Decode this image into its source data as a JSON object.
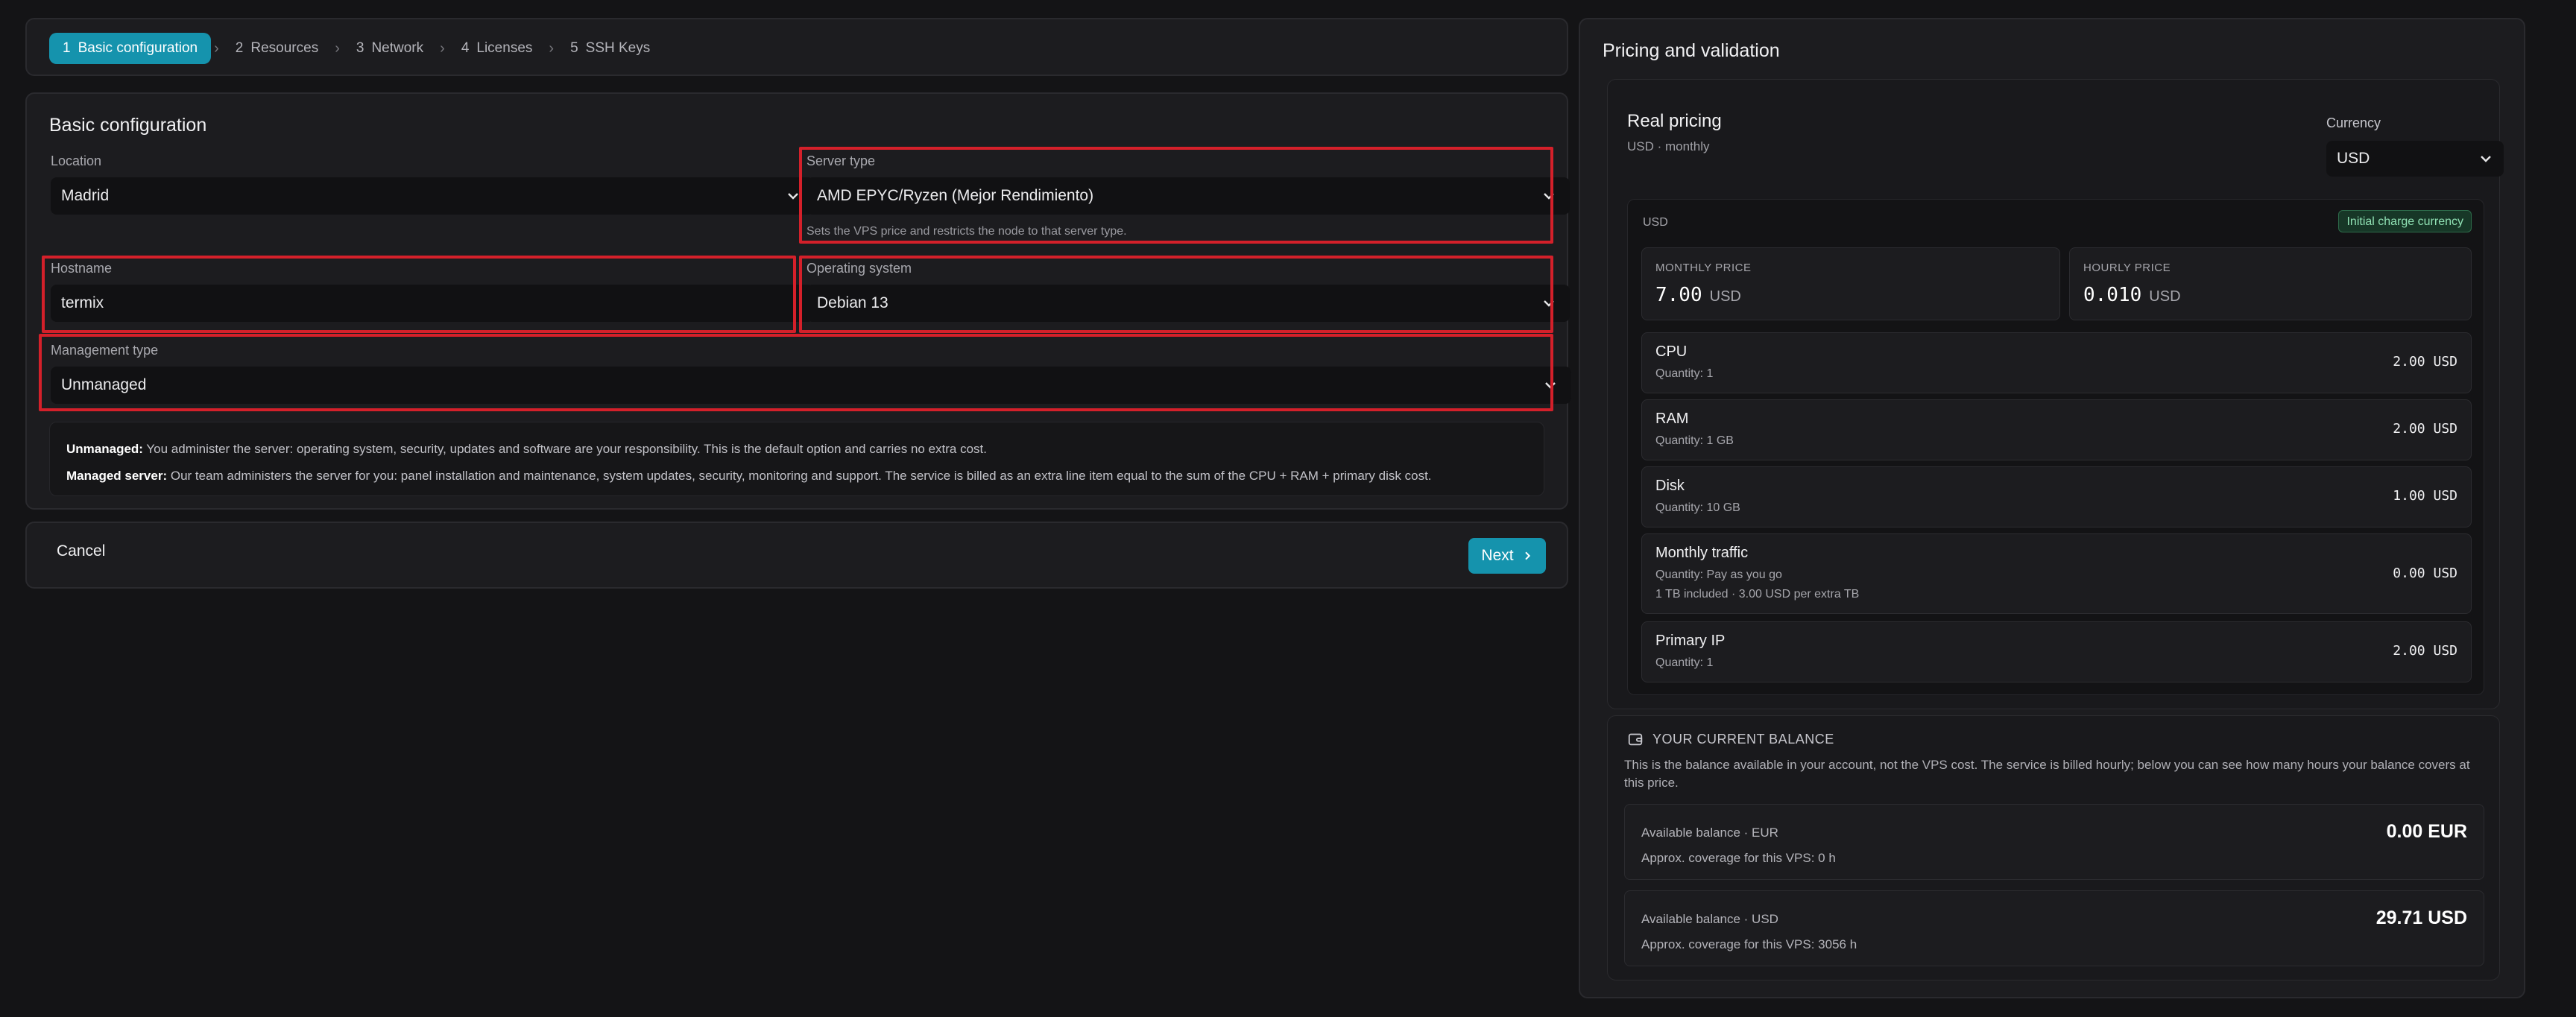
{
  "stepper": {
    "steps": [
      {
        "num": "1",
        "label": "Basic configuration"
      },
      {
        "num": "2",
        "label": "Resources"
      },
      {
        "num": "3",
        "label": "Network"
      },
      {
        "num": "4",
        "label": "Licenses"
      },
      {
        "num": "5",
        "label": "SSH Keys"
      }
    ],
    "active_index": 0
  },
  "config": {
    "title": "Basic configuration",
    "location": {
      "label": "Location",
      "value": "Madrid"
    },
    "server_type": {
      "label": "Server type",
      "value": "AMD EPYC/Ryzen (Mejor Rendimiento)",
      "hint": "Sets the VPS price and restricts the node to that server type."
    },
    "hostname": {
      "label": "Hostname",
      "value": "termix"
    },
    "os": {
      "label": "Operating system",
      "value": "Debian 13"
    },
    "management": {
      "label": "Management type",
      "value": "Unmanaged"
    },
    "info": {
      "unmanaged_title": "Unmanaged:",
      "unmanaged_text": " You administer the server: operating system, security, updates and software are your responsibility. This is the default option and carries no extra cost.",
      "managed_title": "Managed server:",
      "managed_text": " Our team administers the server for you: panel installation and maintenance, system updates, security, monitoring and support. The service is billed as an extra line item equal to the sum of the CPU + RAM + primary disk cost."
    }
  },
  "actions": {
    "cancel": "Cancel",
    "next": "Next"
  },
  "pricing": {
    "title": "Pricing and validation",
    "real_title": "Real pricing",
    "real_sub": "USD · monthly",
    "currency_label": "Currency",
    "currency_value": "USD",
    "box_currency": "USD",
    "badge": "Initial charge currency",
    "monthly": {
      "label": "MONTHLY PRICE",
      "value": "7.00",
      "cur": "USD"
    },
    "hourly": {
      "label": "HOURLY PRICE",
      "value": "0.010",
      "cur": "USD"
    },
    "items": [
      {
        "name": "CPU",
        "qty": "Quantity: 1",
        "extra": "",
        "price": "2.00 USD"
      },
      {
        "name": "RAM",
        "qty": "Quantity: 1 GB",
        "extra": "",
        "price": "2.00 USD"
      },
      {
        "name": "Disk",
        "qty": "Quantity: 10 GB",
        "extra": "",
        "price": "1.00 USD"
      },
      {
        "name": "Monthly traffic",
        "qty": "Quantity: Pay as you go",
        "extra": "1 TB included · 3.00 USD per extra TB",
        "price": "0.00 USD"
      },
      {
        "name": "Primary IP",
        "qty": "Quantity: 1",
        "extra": "",
        "price": "2.00 USD"
      }
    ]
  },
  "balance": {
    "title": "YOUR CURRENT BALANCE",
    "desc": "This is the balance available in your account, not the VPS cost. The service is billed hourly; below you can see how many hours your balance covers at this price.",
    "accounts": [
      {
        "label": "Available balance · EUR",
        "coverage": "Approx. coverage for this VPS: 0 h",
        "amount": "0.00 EUR"
      },
      {
        "label": "Available balance · USD",
        "coverage": "Approx. coverage for this VPS: 3056 h",
        "amount": "29.71 USD"
      }
    ]
  }
}
